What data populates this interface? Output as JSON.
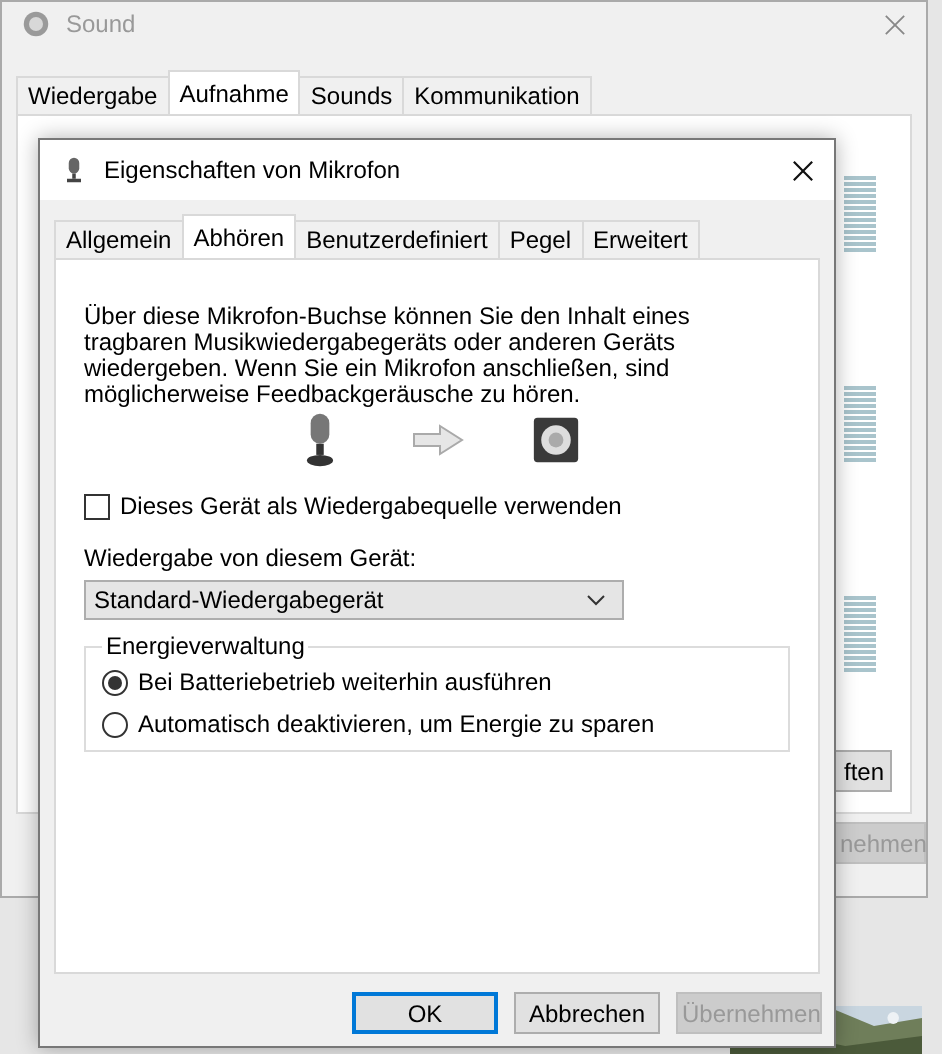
{
  "sound_window": {
    "title": "Sound",
    "tabs": [
      {
        "label": "Wiedergabe",
        "selected": false
      },
      {
        "label": "Aufnahme",
        "selected": true
      },
      {
        "label": "Sounds",
        "selected": false
      },
      {
        "label": "Kommunikation",
        "selected": false
      }
    ],
    "buttons": [
      {
        "label": "ften",
        "disabled": false
      },
      {
        "label": "nehmen",
        "disabled": true
      }
    ]
  },
  "dialog": {
    "title": "Eigenschaften von Mikrofon",
    "tabs": [
      {
        "label": "Allgemein",
        "selected": false
      },
      {
        "label": "Abhören",
        "selected": true
      },
      {
        "label": "Benutzerdefiniert",
        "selected": false
      },
      {
        "label": "Pegel",
        "selected": false
      },
      {
        "label": "Erweitert",
        "selected": false
      }
    ],
    "description": "Über diese Mikrofon-Buchse können Sie den Inhalt eines tragbaren Musikwiedergabegeräts oder anderen Geräts wiedergeben. Wenn Sie ein Mikrofon anschließen, sind möglicherweise Feedbackgeräusche zu hören.",
    "listen_checkbox": {
      "label": "Dieses Gerät als Wiedergabequelle verwenden",
      "checked": false
    },
    "playback_label": "Wiedergabe von diesem Gerät:",
    "playback_device": "Standard-Wiedergabegerät",
    "power": {
      "title": "Energieverwaltung",
      "options": [
        {
          "label": "Bei Batteriebetrieb weiterhin ausführen",
          "selected": true
        },
        {
          "label": "Automatisch deaktivieren, um Energie zu sparen",
          "selected": false
        }
      ]
    },
    "buttons": [
      {
        "label": "OK",
        "kind": "default",
        "disabled": false
      },
      {
        "label": "Abbrechen",
        "kind": "normal",
        "disabled": false
      },
      {
        "label": "Übernehmen",
        "kind": "normal",
        "disabled": true
      }
    ]
  }
}
